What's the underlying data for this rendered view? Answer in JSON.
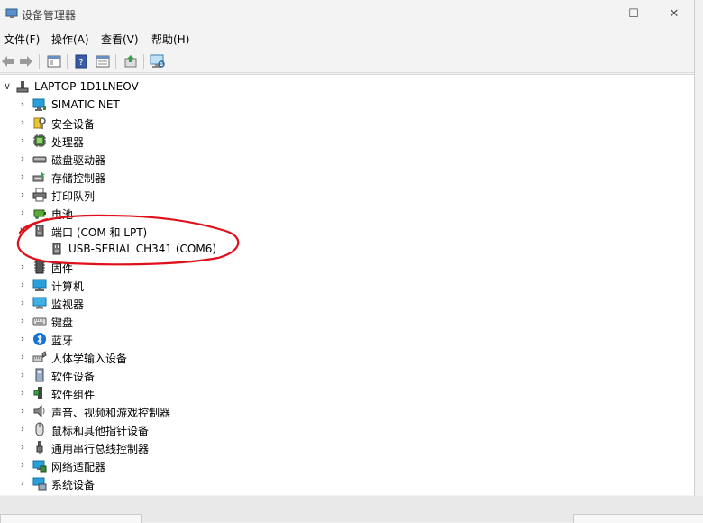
{
  "window": {
    "title": "设备管理器",
    "minimize": "—",
    "maximize": "☐",
    "close": "✕"
  },
  "menu": [
    "文件(F)",
    "操作(A)",
    "查看(V)",
    "帮助(H)"
  ],
  "toolbar": {
    "icons": [
      "back-arrow-icon",
      "forward-arrow-icon",
      "show-hide-console-icon",
      "help-icon",
      "properties-icon",
      "update-driver-icon",
      "scan-hardware-icon"
    ]
  },
  "tree": {
    "root": "LAPTOP-1D1LNEOV",
    "items": [
      {
        "label": "SIMATIC NET",
        "icon": "network-monitor-icon",
        "expanded": false
      },
      {
        "label": "安全设备",
        "icon": "security-key-icon",
        "expanded": false
      },
      {
        "label": "处理器",
        "icon": "processor-chip-icon",
        "expanded": false
      },
      {
        "label": "磁盘驱动器",
        "icon": "disk-drive-icon",
        "expanded": false
      },
      {
        "label": "存储控制器",
        "icon": "storage-controller-icon",
        "expanded": false
      },
      {
        "label": "打印队列",
        "icon": "printer-icon",
        "expanded": false
      },
      {
        "label": "电池",
        "icon": "battery-icon",
        "expanded": false
      },
      {
        "label": "端口 (COM 和 LPT)",
        "icon": "port-icon",
        "expanded": true,
        "children": [
          {
            "label": "USB-SERIAL CH341 (COM6)",
            "icon": "port-icon"
          }
        ]
      },
      {
        "label": "固件",
        "icon": "firmware-chip-icon",
        "expanded": false
      },
      {
        "label": "计算机",
        "icon": "computer-icon",
        "expanded": false
      },
      {
        "label": "监视器",
        "icon": "monitor-icon",
        "expanded": false
      },
      {
        "label": "键盘",
        "icon": "keyboard-icon",
        "expanded": false
      },
      {
        "label": "蓝牙",
        "icon": "bluetooth-icon",
        "expanded": false
      },
      {
        "label": "人体学输入设备",
        "icon": "hid-icon",
        "expanded": false
      },
      {
        "label": "软件设备",
        "icon": "software-device-icon",
        "expanded": false
      },
      {
        "label": "软件组件",
        "icon": "software-component-icon",
        "expanded": false
      },
      {
        "label": "声音、视频和游戏控制器",
        "icon": "speaker-icon",
        "expanded": false
      },
      {
        "label": "鼠标和其他指针设备",
        "icon": "mouse-icon",
        "expanded": false
      },
      {
        "label": "通用串行总线控制器",
        "icon": "usb-icon",
        "expanded": false
      },
      {
        "label": "网络适配器",
        "icon": "network-adapter-icon",
        "expanded": false
      },
      {
        "label": "系统设备",
        "icon": "system-device-icon",
        "expanded": false
      }
    ]
  },
  "colors": {
    "annotation": "#e0101a",
    "window_bg": "#f3f3f3",
    "tree_bg": "#ffffff"
  }
}
